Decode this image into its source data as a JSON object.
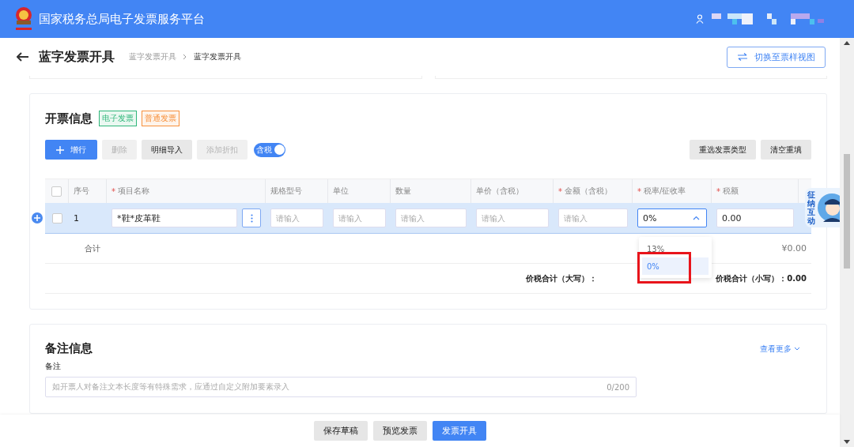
{
  "header": {
    "title": "国家税务总局电子发票服务平台"
  },
  "page": {
    "title": "蓝字发票开具",
    "breadcrumb": [
      {
        "label": "蓝字发票开具",
        "current": false
      },
      {
        "label": "蓝字发票开具",
        "current": true
      }
    ],
    "switch_button": "切换至票样视图"
  },
  "invoice": {
    "title": "开票信息",
    "tags": [
      {
        "label": "电子发票",
        "color": "#2fb67a"
      },
      {
        "label": "普通发票",
        "color": "#f7903b"
      }
    ],
    "toolbar": [
      {
        "label": "增行",
        "kind": "primary"
      },
      {
        "label": "删除",
        "kind": "disabled"
      },
      {
        "label": "明细导入",
        "kind": "default"
      },
      {
        "label": "添加折扣",
        "kind": "disabled"
      }
    ],
    "tax_toggle": {
      "label": "含税",
      "on": true
    },
    "actions": [
      "重选发票类型",
      "清空重填"
    ],
    "select_all": {
      "checked": false
    },
    "columns": [
      {
        "label": "序号"
      },
      {
        "mark": "*",
        "label": "项目名称"
      },
      {
        "label": "规格型号"
      },
      {
        "label": "单位"
      },
      {
        "label": "数量"
      },
      {
        "label": "单价（含税）"
      },
      {
        "mark": "*",
        "label": "金额（含税）"
      },
      {
        "mark": "*",
        "label": "税率/征收率"
      },
      {
        "mark": "*",
        "label": "税额"
      }
    ],
    "rows": [
      {
        "index": "1",
        "checked": false,
        "item_name": "*鞋*皮革鞋",
        "spec": {
          "placeholder": "请输入"
        },
        "unit": {
          "placeholder": "请输入"
        },
        "quantity": {
          "placeholder": "请输入"
        },
        "price": {
          "placeholder": "请输入"
        },
        "amount": {
          "placeholder": "请输入"
        },
        "tax_rate": {
          "value": "0%",
          "expanded": true
        },
        "tax": "0.00"
      }
    ],
    "rate_options": [
      {
        "label": "13%",
        "selected": false
      },
      {
        "label": "0%",
        "selected": true
      }
    ],
    "total": {
      "label": "合计",
      "amount": "¥0.00"
    },
    "grand_total": {
      "words_label": "价税合计（大写）：",
      "number_label": "价税合计（小写）：",
      "number": "0.00"
    }
  },
  "remarks": {
    "title": "备注信息",
    "more_link": "查看更多",
    "field_label": "备注",
    "placeholder": "如开票人对备注文本长度等有特殊需求，应通过自定义附加要素录入",
    "counter": "0/200"
  },
  "mascot": {
    "label": "征纳互动"
  },
  "footer": [
    {
      "label": "保存草稿",
      "kind": "default"
    },
    {
      "label": "预览发票",
      "kind": "default"
    },
    {
      "label": "发票开具",
      "kind": "primary"
    }
  ]
}
